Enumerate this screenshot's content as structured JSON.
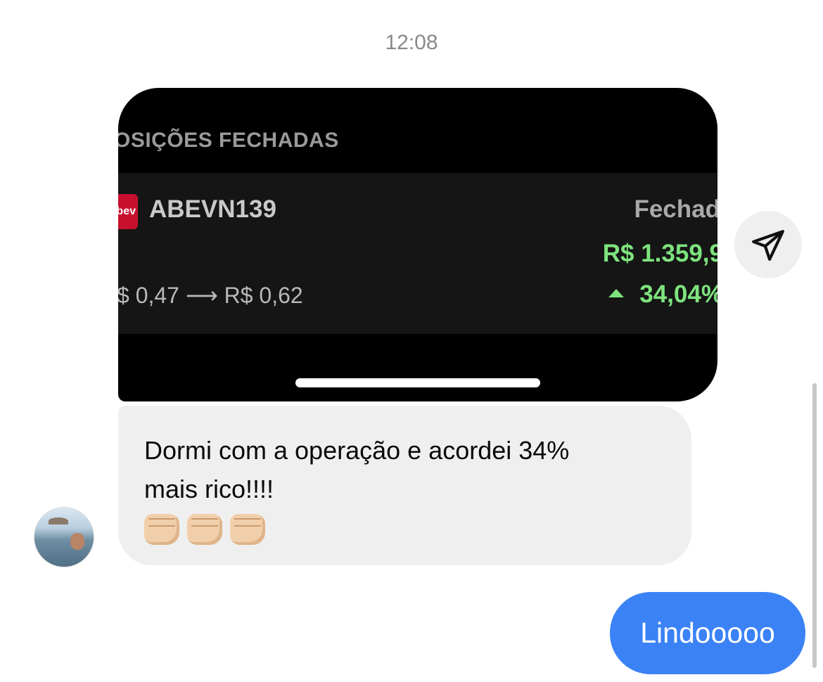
{
  "timestamp": "12:08",
  "shared_image": {
    "header": "OSIÇÕES FECHADAS",
    "logo_text": "bev",
    "ticker": "ABEVN139",
    "status": "Fechad",
    "value": "R$ 1.359,9",
    "price_range": "$ 0,47 ⟶ R$ 0,62",
    "change": "34,04%",
    "colors": {
      "gain": "#7ee37e",
      "logo": "#c8102e"
    }
  },
  "share_button": {
    "icon": "paper-plane-icon"
  },
  "incoming_message": {
    "text": "Dormi com a operação e acordei 34%\nmais rico!!!!",
    "emojis": [
      "oncoming-fist",
      "oncoming-fist",
      "oncoming-fist"
    ]
  },
  "avatar": {
    "icon": "avatar-photo"
  },
  "outgoing_message": {
    "text": "Lindooooo",
    "color": "#3b82f6"
  }
}
